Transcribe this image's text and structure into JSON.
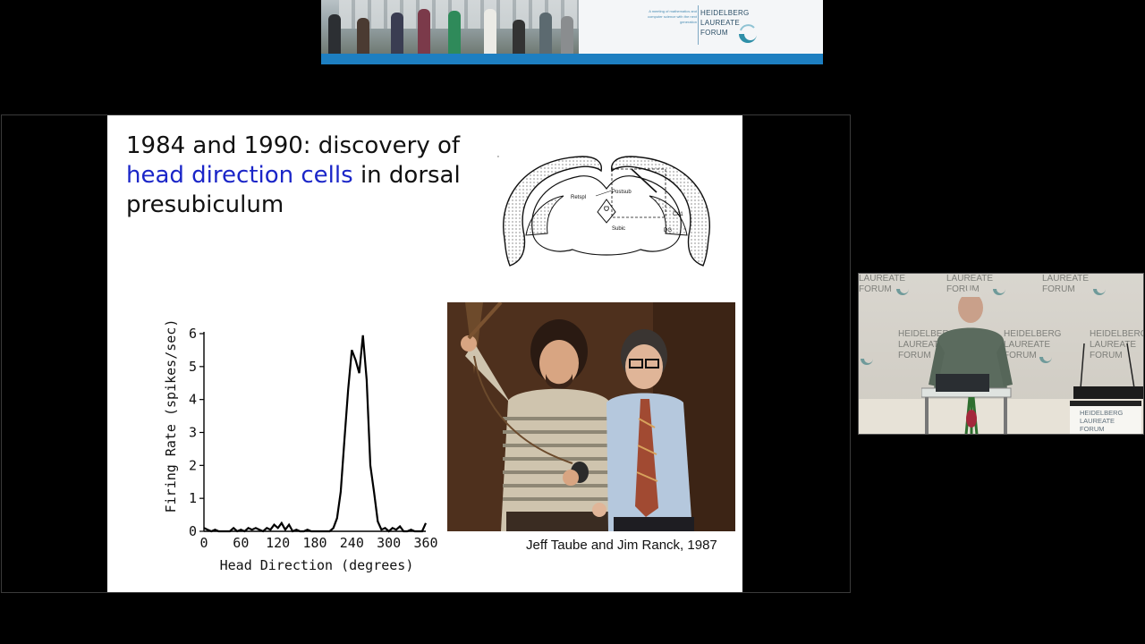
{
  "banner": {
    "tagline": "A meeting of mathematics and computer science with the next generation",
    "logo_line1": "HEIDELBERG",
    "logo_line2": "LAUREATE",
    "logo_line3": "FORUM"
  },
  "slide": {
    "title_part1": "1984 and 1990: discovery of",
    "title_highlight": "head direction cells",
    "title_part2": "in dorsal presubiculum",
    "brain_labels": {
      "retspl": "Retspl",
      "postsub": "Postsub",
      "subic": "Subic",
      "ca1": "CA1",
      "dg": "DG"
    },
    "photo_caption": "Jeff Taube and Jim Ranck, 1987"
  },
  "chart_data": {
    "type": "line",
    "title": "",
    "xlabel": "Head Direction (degrees)",
    "ylabel": "Firing Rate (spikes/sec)",
    "xlim": [
      0,
      360
    ],
    "ylim": [
      0,
      6
    ],
    "xticks": [
      "0",
      "60",
      "120",
      "180",
      "240",
      "300",
      "360"
    ],
    "yticks": [
      "0",
      "1",
      "2",
      "3",
      "4",
      "5",
      "6"
    ],
    "grid": false,
    "series": [
      {
        "x": [
          0,
          6,
          12,
          18,
          24,
          30,
          36,
          42,
          48,
          54,
          60,
          66,
          72,
          78,
          84,
          90,
          96,
          102,
          108,
          114,
          120,
          126,
          132,
          138,
          144,
          150,
          156,
          162,
          168,
          174,
          180,
          186,
          192,
          198,
          204,
          210,
          216,
          222,
          228,
          234,
          240,
          246,
          252,
          258,
          264,
          270,
          276,
          282,
          288,
          294,
          300,
          306,
          312,
          318,
          324,
          330,
          336,
          342,
          348,
          354,
          360
        ],
        "y": [
          0.1,
          0.05,
          0.0,
          0.05,
          0.0,
          0.0,
          0.0,
          0.0,
          0.1,
          0.0,
          0.05,
          0.0,
          0.1,
          0.05,
          0.1,
          0.05,
          0.0,
          0.1,
          0.05,
          0.2,
          0.1,
          0.25,
          0.05,
          0.2,
          0.0,
          0.05,
          0.0,
          0.0,
          0.05,
          0.0,
          0.0,
          0.0,
          0.0,
          0.0,
          0.0,
          0.1,
          0.4,
          1.2,
          2.8,
          4.3,
          5.5,
          5.2,
          4.8,
          5.95,
          4.6,
          2.0,
          1.2,
          0.3,
          0.05,
          0.1,
          0.0,
          0.1,
          0.05,
          0.15,
          0.0,
          0.0,
          0.05,
          0.0,
          0.0,
          0.0,
          0.25
        ]
      }
    ]
  },
  "speaker_view": {
    "watermark_laureate": "LAUREATE",
    "watermark_forum": "FORUM",
    "watermark_heidelberg": "HEIDELBERG",
    "lectern_line1": "HEIDELBERG",
    "lectern_line2": "LAUREATE",
    "lectern_line3": "FORUM"
  },
  "colors": {
    "slide_highlight": "#1b26c8",
    "banner_stripe": "#1d7fc1",
    "logo_teal": "#2f8fa8"
  }
}
